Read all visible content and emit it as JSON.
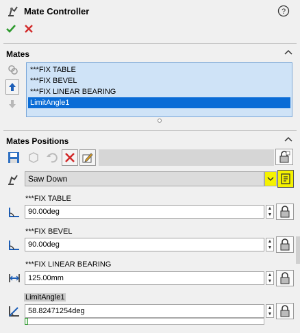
{
  "header": {
    "title": "Mate Controller"
  },
  "mates_section": {
    "heading": "Mates",
    "items": [
      {
        "label": "***FIX TABLE"
      },
      {
        "label": "***FIX BEVEL"
      },
      {
        "label": "***FIX LINEAR BEARING"
      },
      {
        "label": "LimitAngle1",
        "selected": true
      }
    ]
  },
  "positions_section": {
    "heading": "Mates Positions",
    "position_select": {
      "value": "Saw Down"
    },
    "mates": [
      {
        "label": "***FIX TABLE",
        "value": "90.00deg"
      },
      {
        "label": "***FIX BEVEL",
        "value": "90.00deg"
      },
      {
        "label": "***FIX LINEAR BEARING",
        "value": "125.00mm"
      },
      {
        "label": "LimitAngle1",
        "value": "58.82471254deg",
        "highlight": true
      }
    ]
  },
  "colors": {
    "accent_blue": "#0a6cd6",
    "list_bg": "#cfe3f7",
    "ok_green": "#2e9a2e",
    "cancel_red": "#d22b2b",
    "highlight_yellow": "#f5f200"
  }
}
